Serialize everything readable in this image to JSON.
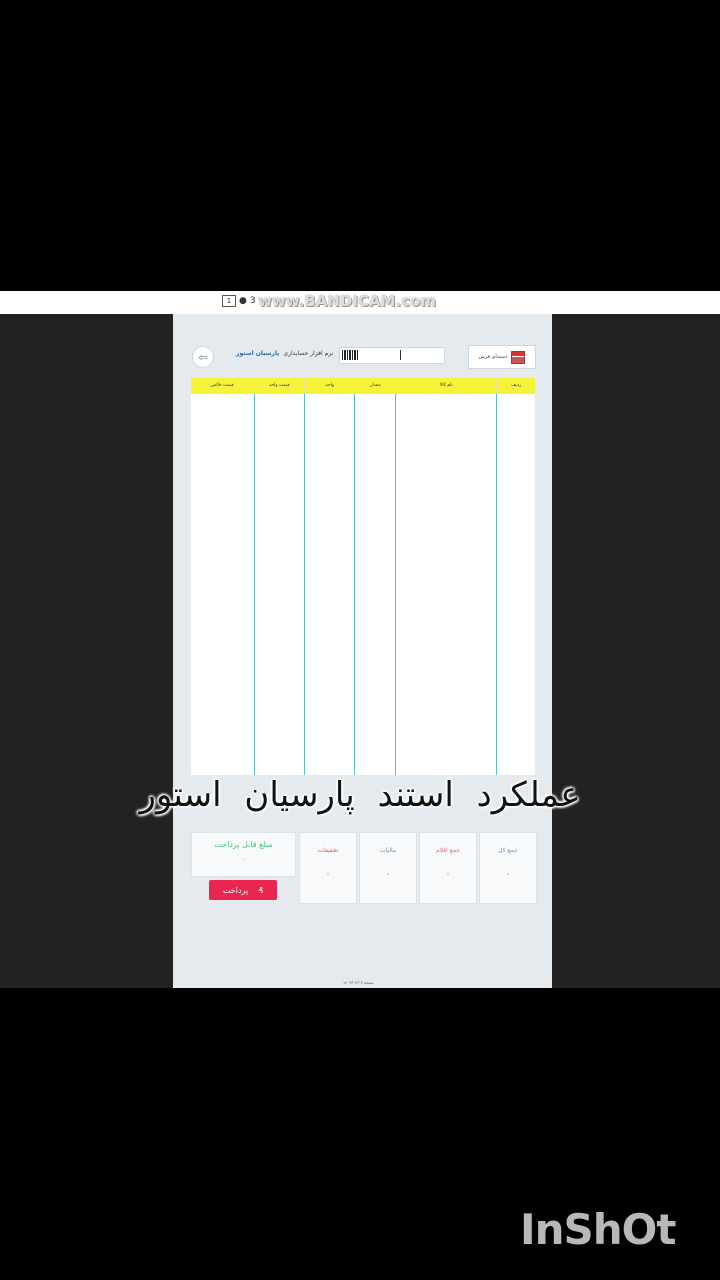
{
  "recorder": {
    "left_number": "1",
    "left_text": "3",
    "watermark": "www.BANDICAM.com"
  },
  "header": {
    "brand_prefix": "نرم افزار حسابداری",
    "brand_name": "پارسیان استور",
    "shop_label": "دسته‌ای فرش"
  },
  "table": {
    "columns": [
      "ردیف",
      "نام کالا",
      "مقدار",
      "واحد",
      "قیمت واحد",
      "قیمت خالص"
    ]
  },
  "overlay_caption": "عملکرد استند پارسیان استور",
  "summary": {
    "cards": [
      {
        "title": "جمع کل",
        "value": "۰",
        "color": "#7b8bd6"
      },
      {
        "title": "جمع اقلام",
        "value": "۰",
        "color": "#e56b8a"
      },
      {
        "title": "مالیات",
        "value": "۰",
        "color": "#7f8c94"
      },
      {
        "title": "تخفیفات",
        "value": "۰",
        "color": "#e05a5a"
      }
    ],
    "payable_title": "مبلغ قابل پرداخت",
    "payable_value": "۰",
    "pay_button": "پرداخت"
  },
  "footer_version": "نسخه ۱۴۰۳/۰۲/۰۷",
  "inshot_watermark": "InShOt"
}
